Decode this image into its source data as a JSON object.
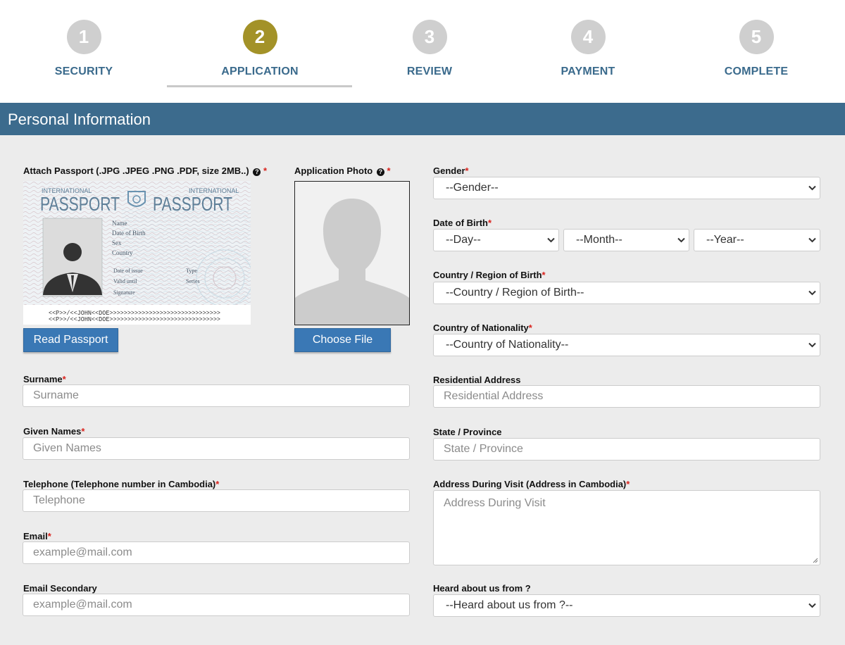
{
  "steps": [
    {
      "number": "1",
      "label": "SECURITY"
    },
    {
      "number": "2",
      "label": "APPLICATION"
    },
    {
      "number": "3",
      "label": "REVIEW"
    },
    {
      "number": "4",
      "label": "PAYMENT"
    },
    {
      "number": "5",
      "label": "COMPLETE"
    }
  ],
  "active_step_index": 1,
  "colors": {
    "active_step": "#a39228",
    "step_label": "#3a6a8c",
    "header_bg": "#3c6b8d",
    "button": "#3a78b5",
    "required": "#d9231d"
  },
  "section_title": "Personal Information",
  "passport": {
    "label": "Attach Passport (.JPG .JPEG .PNG .PDF, size 2MB..)",
    "required_mark": "*",
    "help_icon": "question-circle-icon",
    "sample": {
      "international_left": "INTERNATIONAL",
      "international_right": "INTERNATIONAL",
      "title_left": "PASSPORT",
      "title_right": "PASSPORT",
      "fields_a": [
        "Name",
        "Date of Birth",
        "Sex",
        "Country"
      ],
      "fields_b": [
        "Date of issue",
        "Valid until",
        "Signature"
      ],
      "fields_c": [
        "Type",
        "Series"
      ],
      "mrz_line1": "<<P>>/<<JOHN<<DOE>>>>>>>>>>>>>>>>>>>>>>>>>>>>>>>",
      "mrz_line2": "<<P>>/<<JOHN<<DOE>>>>>>>>>>>>>>>>>>>>>>>>>>>>>>>"
    },
    "button": "Read Passport"
  },
  "photo": {
    "label": "Application Photo",
    "required_mark": "*",
    "help_icon": "question-circle-icon",
    "button": "Choose File"
  },
  "left_fields": {
    "surname": {
      "label": "Surname",
      "required_mark": "*",
      "placeholder": "Surname"
    },
    "given_names": {
      "label": "Given Names",
      "required_mark": "*",
      "placeholder": "Given Names"
    },
    "telephone": {
      "label": "Telephone (Telephone number in Cambodia)",
      "required_mark": "*",
      "placeholder": "Telephone"
    },
    "email": {
      "label": "Email",
      "required_mark": "*",
      "placeholder": "example@mail.com"
    },
    "email_secondary": {
      "label": "Email Secondary",
      "placeholder": "example@mail.com"
    }
  },
  "right_fields": {
    "gender": {
      "label": "Gender",
      "required_mark": "*",
      "value": "--Gender--"
    },
    "dob": {
      "label": "Date of Birth",
      "required_mark": "*",
      "day": "--Day--",
      "month": "--Month--",
      "year": "--Year--"
    },
    "country_birth": {
      "label": "Country / Region of Birth",
      "required_mark": "*",
      "value": "--Country / Region of Birth--"
    },
    "nationality": {
      "label": "Country of Nationality",
      "required_mark": "*",
      "value": "--Country of Nationality--"
    },
    "residential": {
      "label": "Residential Address",
      "placeholder": "Residential Address"
    },
    "state": {
      "label": "State / Province",
      "placeholder": "State / Province"
    },
    "visit_address": {
      "label": "Address During Visit (Address in Cambodia)",
      "required_mark": "*",
      "placeholder": "Address During Visit"
    },
    "heard": {
      "label": "Heard about us from ?",
      "value": "--Heard about us from ?--"
    }
  }
}
